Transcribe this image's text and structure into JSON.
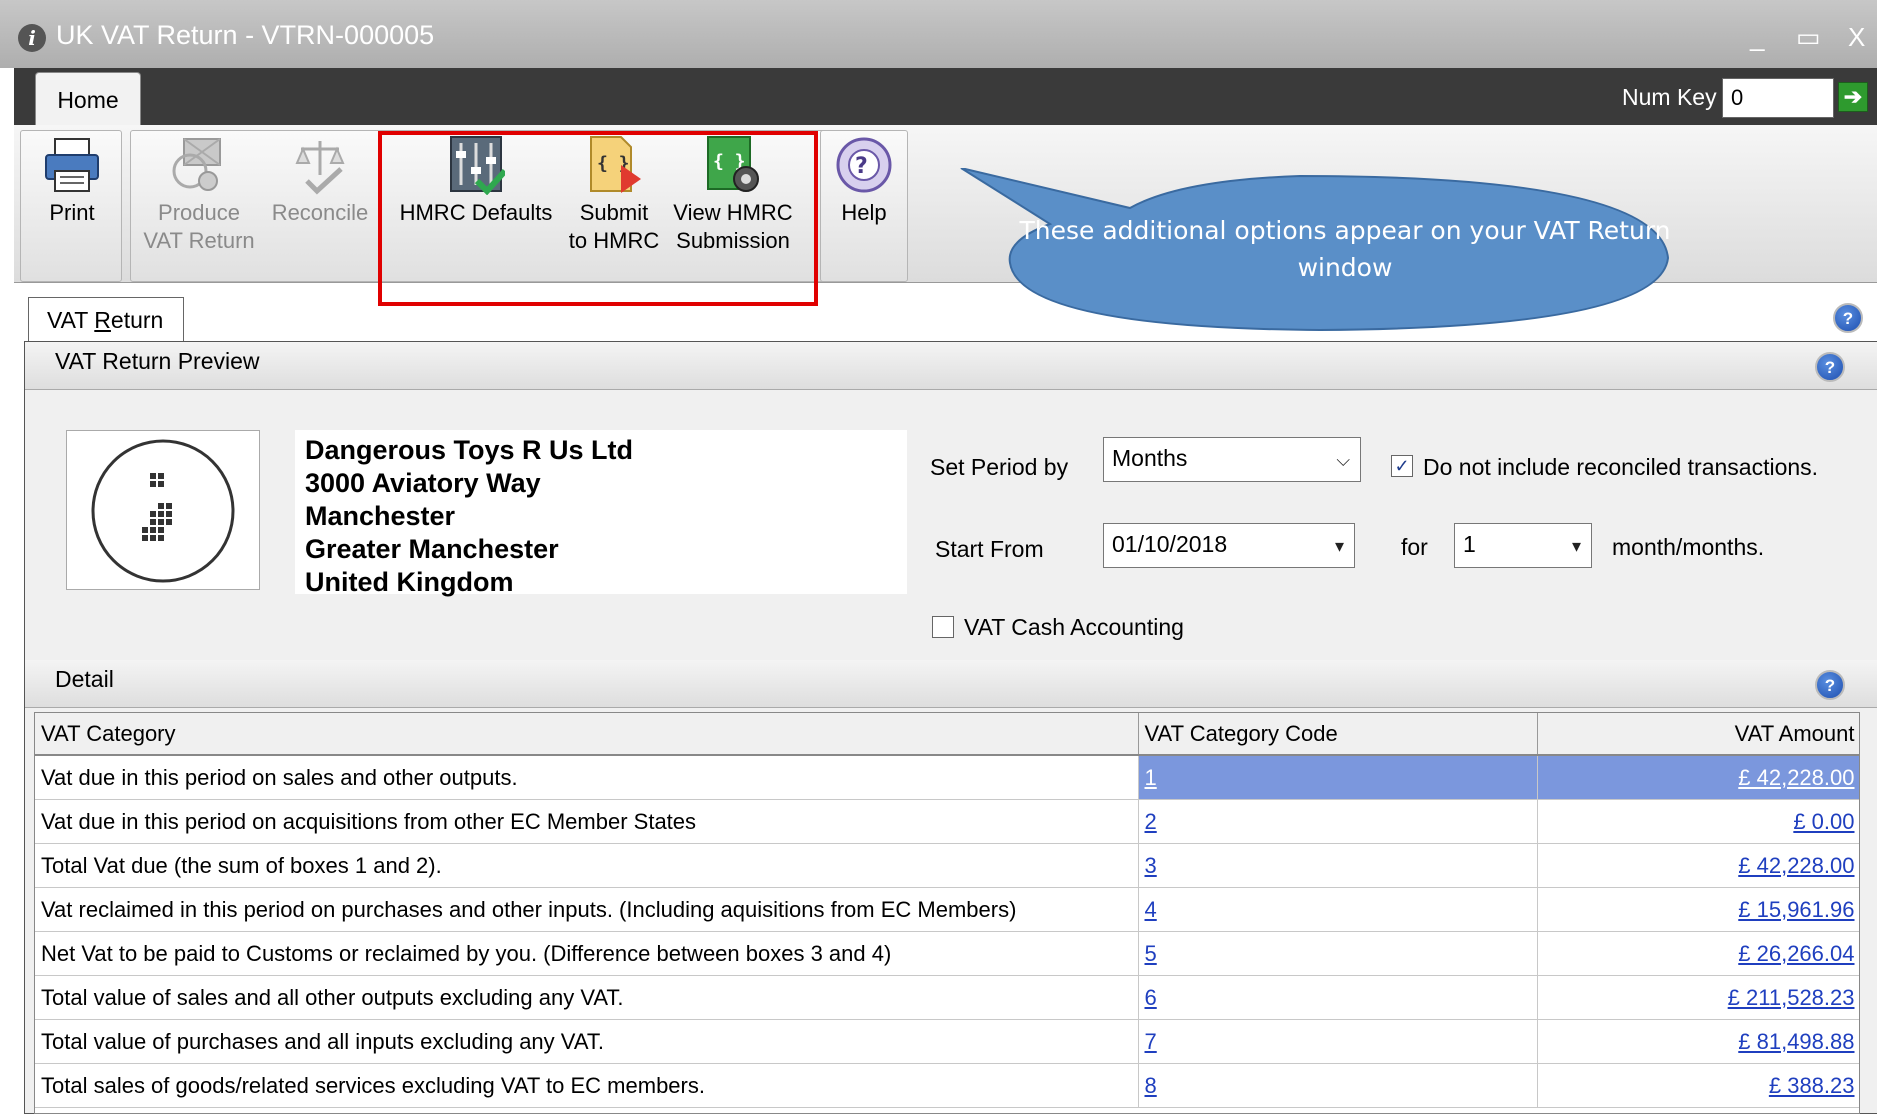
{
  "window": {
    "title": "UK VAT Return  - VTRN-000005",
    "info_icon": "info-icon",
    "controls": {
      "minimize": "_",
      "maximize": "▭",
      "close": "X"
    }
  },
  "ribbon": {
    "tabs": [
      {
        "label": "Home",
        "active": true
      }
    ],
    "num_key": {
      "label": "Num Key",
      "value": "0",
      "go_icon": "green-arrow-right-icon"
    },
    "buttons": [
      {
        "label": "Print",
        "icon": "printer-icon",
        "enabled": true
      },
      {
        "label": "Produce\nVAT Return",
        "icon": "produce-vat-return-icon",
        "enabled": false
      },
      {
        "label": "Reconcile",
        "icon": "reconcile-scales-icon",
        "enabled": false
      },
      {
        "label": "HMRC Defaults",
        "icon": "hmrc-defaults-sliders-icon",
        "enabled": true
      },
      {
        "label": "Submit\nto HMRC",
        "icon": "submit-document-arrow-icon",
        "enabled": true
      },
      {
        "label": "View HMRC\nSubmission",
        "icon": "view-submission-gear-icon",
        "enabled": true
      },
      {
        "label": "Help",
        "icon": "help-lifebuoy-icon",
        "enabled": true
      }
    ]
  },
  "callout": {
    "text": "These additional options appear on your VAT Return window",
    "color": "#5a8fc8"
  },
  "vat_return_tab": {
    "label_prefix": "VAT ",
    "label_underlined": "R",
    "label_suffix": "eturn"
  },
  "preview": {
    "header": "VAT Return Preview",
    "company": {
      "name": "Dangerous Toys R Us Ltd",
      "address_line1": "3000 Aviatory Way",
      "city": "Manchester",
      "county": "Greater Manchester",
      "country": "United Kingdom"
    },
    "set_period_by": {
      "label": "Set Period by",
      "value": "Months"
    },
    "start_from": {
      "label": "Start From",
      "value": "01/10/2018"
    },
    "for_label": "for",
    "period_count": "1",
    "period_unit": "month/months.",
    "exclude_reconciled": {
      "label": "Do not include reconciled transactions.",
      "checked": true
    },
    "cash_accounting": {
      "label": "VAT Cash Accounting",
      "checked": false
    }
  },
  "detail": {
    "header": "Detail",
    "columns": [
      "VAT Category",
      "VAT Category Code",
      "VAT Amount"
    ],
    "rows": [
      {
        "category": "Vat due in this period on sales and other outputs.",
        "code": "1",
        "amount": "£ 42,228.00",
        "selected": true
      },
      {
        "category": "Vat due in this period on acquisitions from other EC Member States",
        "code": "2",
        "amount": "£ 0.00"
      },
      {
        "category": "Total Vat due (the sum of boxes 1 and 2).",
        "code": "3",
        "amount": "£ 42,228.00"
      },
      {
        "category": "Vat reclaimed in this period on purchases and other inputs. (Including aquisitions from EC Members)",
        "code": "4",
        "amount": "£ 15,961.96"
      },
      {
        "category": "Net Vat to be paid to Customs or reclaimed by you. (Difference between boxes 3 and 4)",
        "code": "5",
        "amount": "£ 26,266.04"
      },
      {
        "category": "Total value of sales and all other outputs excluding any VAT.",
        "code": "6",
        "amount": "£ 211,528.23"
      },
      {
        "category": "Total value of purchases and all inputs excluding any VAT.",
        "code": "7",
        "amount": "£ 81,498.88"
      },
      {
        "category": "Total sales of goods/related services excluding VAT to EC members.",
        "code": "8",
        "amount": "£ 388.23"
      }
    ]
  }
}
